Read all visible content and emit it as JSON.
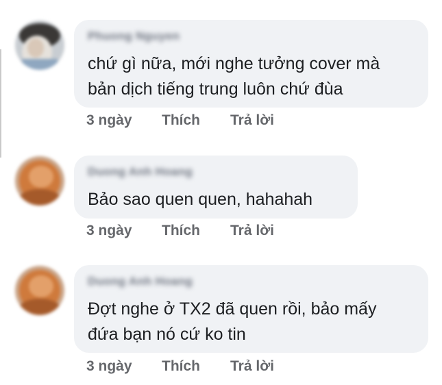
{
  "comments": [
    {
      "author": "Phuong Nguyen",
      "lines": [
        "chứ gì nữa, mới nghe tưởng cover mà",
        "bản dịch tiếng trung luôn chứ đùa"
      ],
      "time": "3 ngày",
      "like_label": "Thích",
      "reply_label": "Trả lời"
    },
    {
      "author": "Duong Anh Hoang",
      "lines": [
        "Bảo sao quen quen, hahahah"
      ],
      "time": "3 ngày",
      "like_label": "Thích",
      "reply_label": "Trả lời"
    },
    {
      "author": "Duong Anh Hoang",
      "lines": [
        "Đợt nghe ở TX2 đã quen rồi, bảo mấy",
        "đứa bạn nó cứ ko tin"
      ],
      "time": "3 ngày",
      "like_label": "Thích",
      "reply_label": "Trả lời"
    }
  ],
  "colors": {
    "bubble": "#f0f2f5",
    "text": "#1c1e21",
    "meta": "#65676b"
  }
}
